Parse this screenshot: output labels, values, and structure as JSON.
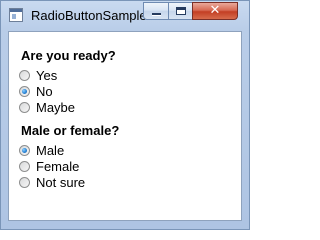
{
  "window": {
    "title": "RadioButtonSample",
    "icon": "application-window-icon",
    "controls": {
      "minimize": "minimize-icon",
      "maximize": "maximize-icon",
      "close": "close-icon",
      "close_glyph": "✕"
    }
  },
  "groups": [
    {
      "label": "Are you ready?",
      "options": [
        {
          "label": "Yes",
          "checked": false
        },
        {
          "label": "No",
          "checked": true
        },
        {
          "label": "Maybe",
          "checked": false
        }
      ]
    },
    {
      "label": "Male or female?",
      "options": [
        {
          "label": "Male",
          "checked": true
        },
        {
          "label": "Female",
          "checked": false
        },
        {
          "label": "Not sure",
          "checked": false
        }
      ]
    }
  ],
  "colors": {
    "frame": "#aec4e3",
    "close_button": "#c33f24",
    "radio_selected": "#2a86d8"
  }
}
